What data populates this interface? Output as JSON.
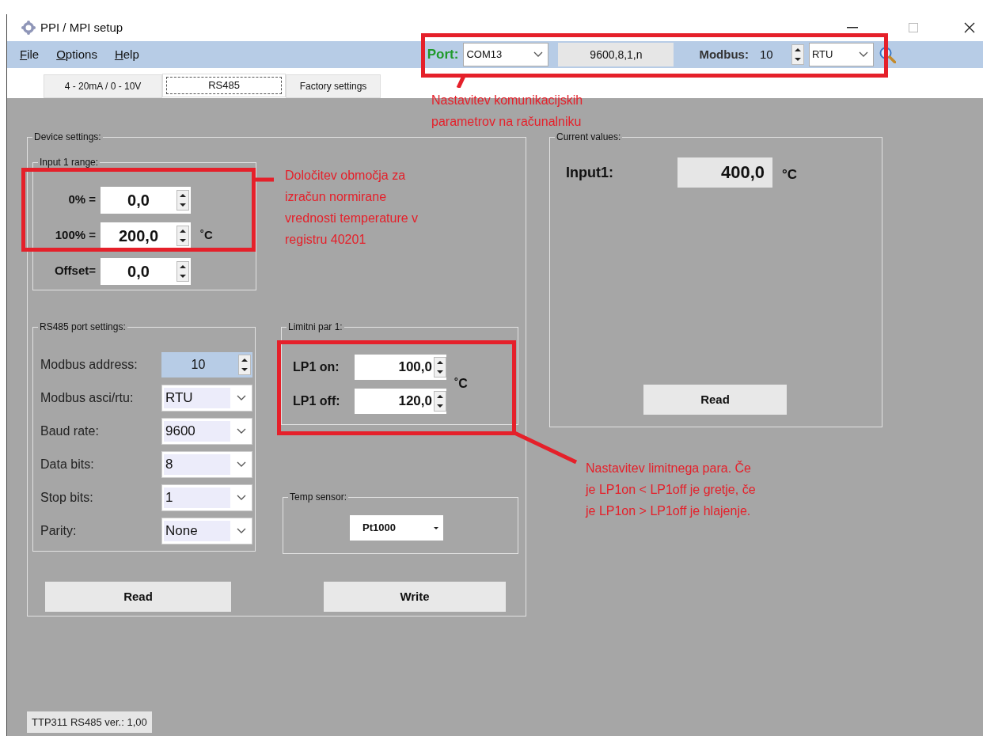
{
  "window": {
    "title": "PPI / MPI setup"
  },
  "menu": [
    {
      "label": "File"
    },
    {
      "label": "Options"
    },
    {
      "label": "Help"
    }
  ],
  "toolbar": {
    "port_label": "Port:",
    "port": "COM13",
    "settings": "9600,8,1,n",
    "modbus_label": "Modbus:",
    "modbus_address": "10",
    "protocol": "RTU"
  },
  "tabs": [
    {
      "label": "4 - 20mA / 0 - 10V",
      "selected": false
    },
    {
      "label": "RS485",
      "selected": true
    },
    {
      "label": "Factory settings",
      "selected": false
    }
  ],
  "device_settings": {
    "title": "Device settings:",
    "input_range": {
      "title": "Input 1 range:",
      "unit": "˚C",
      "rows": [
        {
          "label": "0% =",
          "value": "0,0"
        },
        {
          "label": "100% =",
          "value": "200,0"
        },
        {
          "label": "Offset=",
          "value": "0,0"
        }
      ]
    },
    "rs485": {
      "title": "RS485 port settings:",
      "rows": [
        {
          "kind": "spinner",
          "label": "Modbus address:",
          "value": "10",
          "highlighted": true
        },
        {
          "kind": "combo",
          "label": "Modbus asci/rtu:",
          "value": "RTU",
          "highlighted": false
        },
        {
          "kind": "combo",
          "label": "Baud rate:",
          "value": "9600",
          "highlighted": false
        },
        {
          "kind": "combo",
          "label": "Data bits:",
          "value": "8",
          "highlighted": false
        },
        {
          "kind": "combo",
          "label": "Stop bits:",
          "value": "1",
          "highlighted": false
        },
        {
          "kind": "combo",
          "label": "Parity:",
          "value": "None",
          "highlighted": false
        }
      ]
    },
    "limit_pair": {
      "title": "Limitni par 1:",
      "unit": "˚C",
      "rows": [
        {
          "label": "LP1 on:",
          "value": "100,0"
        },
        {
          "label": "LP1 off:",
          "value": "120,0"
        }
      ]
    },
    "temp_sensor": {
      "title": "Temp sensor:",
      "value": "Pt1000"
    },
    "buttons": [
      "Read",
      "Write"
    ]
  },
  "current_values": {
    "title": "Current values:",
    "label": "Input1:",
    "value": "400,0",
    "unit": "°C",
    "button": "Read"
  },
  "status_bar": "TTP311 RS485  ver.: 1,00",
  "annotations": [
    {
      "lines": [
        "Nastavitev komunikacijskih",
        "parametrov na računalniku"
      ]
    },
    {
      "lines": [
        "Določitev območja za",
        "izračun normirane",
        "vrednosti temperature v",
        "registru 40201"
      ]
    },
    {
      "lines": [
        "Nastavitev limitnega para. Če",
        "je LP1on < LP1off je gretje, če",
        "je LP1on > LP1off je hlajenje."
      ]
    }
  ]
}
